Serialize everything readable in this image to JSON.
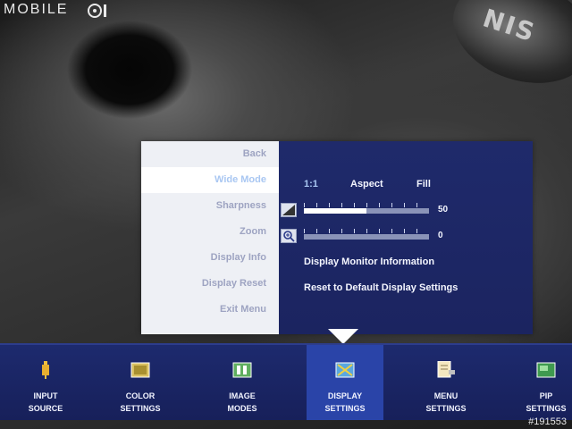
{
  "watermark": {
    "text": "MOBILE"
  },
  "photo_id": "#191553",
  "background": {
    "emblem_text": "NIS"
  },
  "menu": {
    "items": [
      {
        "label": "Back"
      },
      {
        "label": "Wide Mode"
      },
      {
        "label": "Sharpness"
      },
      {
        "label": "Zoom"
      },
      {
        "label": "Display Info"
      },
      {
        "label": "Display Reset"
      },
      {
        "label": "Exit Menu"
      }
    ],
    "active_index": 1,
    "wide_mode": {
      "options": [
        "1:1",
        "Aspect",
        "Fill"
      ],
      "selected_index": 0
    },
    "sharpness": {
      "value": 50,
      "max": 100,
      "value_label": "50"
    },
    "zoom": {
      "value": 0,
      "max": 100,
      "value_label": "0"
    },
    "display_info": {
      "text": "Display Monitor Information"
    },
    "display_reset": {
      "text": "Reset to Default Display Settings"
    }
  },
  "bottom_bar": {
    "active_index": 3,
    "tabs": [
      {
        "label": "INPUT\nSOURCE",
        "icon": "input-source-icon"
      },
      {
        "label": "COLOR\nSETTINGS",
        "icon": "color-settings-icon"
      },
      {
        "label": "IMAGE\nMODES",
        "icon": "image-modes-icon"
      },
      {
        "label": "DISPLAY\nSETTINGS",
        "icon": "display-settings-icon"
      },
      {
        "label": "MENU\nSETTINGS",
        "icon": "menu-settings-icon"
      },
      {
        "label": "PIP\nSETTINGS",
        "icon": "pip-settings-icon"
      }
    ]
  },
  "colors": {
    "menu_left_bg": "#eef0f5",
    "menu_right_bg": "#1f2a6b",
    "active_text": "#a9c7f2",
    "bar_bg": "#1d2a6e",
    "bar_active": "#2a44a8"
  }
}
